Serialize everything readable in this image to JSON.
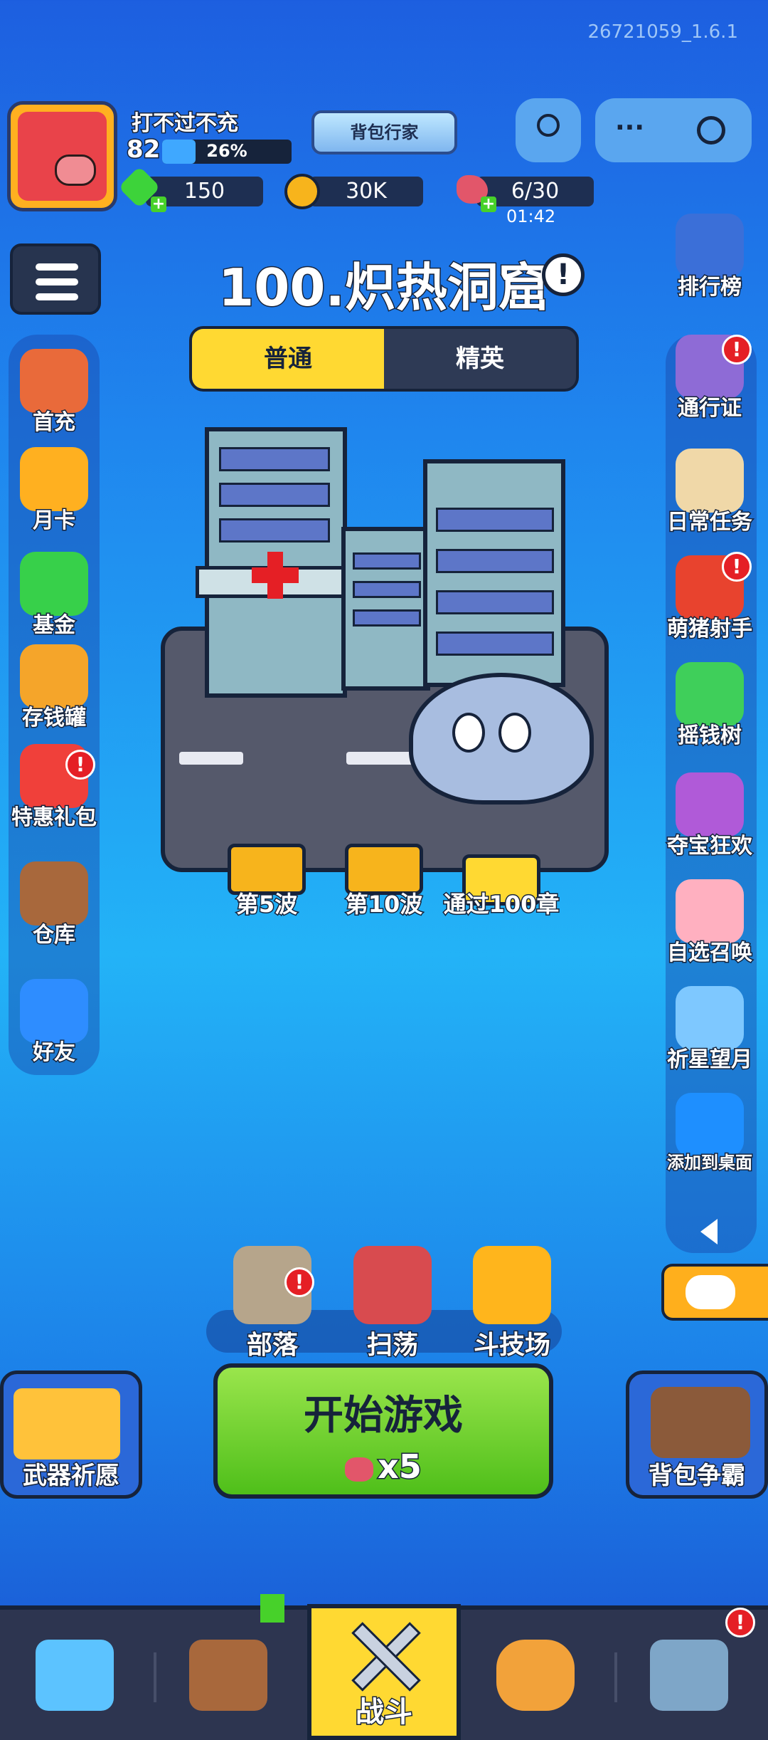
{
  "version": "26721059_1.6.1",
  "player": {
    "name": "打不过不充",
    "level": "82",
    "xp_percent": "26%",
    "xp_fraction": 0.26
  },
  "resources": {
    "gems": "150",
    "coins": "30K",
    "stamina": "6/30",
    "stamina_timer": "01:42"
  },
  "title_badge": "背包行家",
  "level": {
    "title": "100.炽热洞窟",
    "info": "!"
  },
  "tabs": {
    "normal": "普通",
    "elite": "精英"
  },
  "left_menu": [
    "首充",
    "月卡",
    "基金",
    "存钱罐",
    "特惠礼包",
    "仓库",
    "好友"
  ],
  "right_menu": [
    "排行榜",
    "通行证",
    "日常任务",
    "萌猪射手",
    "摇钱树",
    "夺宝狂欢",
    "自选召唤",
    "祈星望月",
    "添加到桌面"
  ],
  "alert_mark": "!",
  "rewards": [
    "第5波",
    "第10波",
    "通过100章"
  ],
  "modes": [
    "部落",
    "扫荡",
    "斗技场"
  ],
  "start": {
    "title": "开始游戏",
    "cost": "x5"
  },
  "side_big": {
    "left": "武器祈愿",
    "right": "背包争霸"
  },
  "nav": {
    "battle": "战斗"
  },
  "colors": {
    "accent_yellow": "#ffd932",
    "start_green": "#6fd12a",
    "alert_red": "#e51f25",
    "panel_dark": "#2d3550"
  }
}
